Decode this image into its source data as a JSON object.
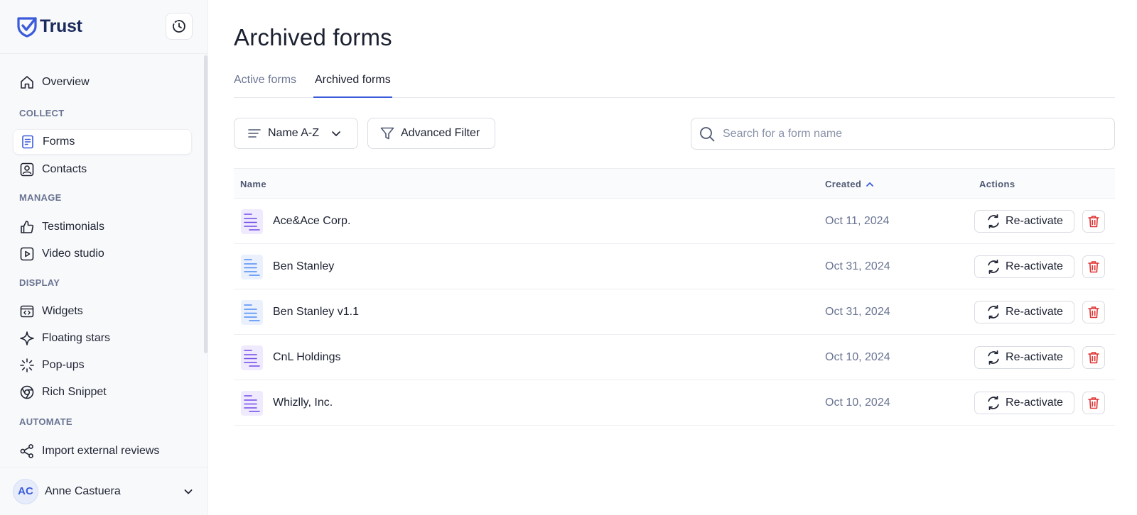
{
  "brand": {
    "name": "Trust",
    "accent": "#3b5bdb"
  },
  "sidebar": {
    "overview": "Overview",
    "sections": {
      "collect": "COLLECT",
      "manage": "MANAGE",
      "display": "DISPLAY",
      "automate": "AUTOMATE"
    },
    "items": {
      "forms": "Forms",
      "contacts": "Contacts",
      "testimonials": "Testimonials",
      "video_studio": "Video studio",
      "widgets": "Widgets",
      "floating_stars": "Floating stars",
      "popups": "Pop-ups",
      "rich_snippet": "Rich Snippet",
      "import_reviews": "Import external reviews"
    },
    "active_item": "forms",
    "user": {
      "initials": "AC",
      "name": "Anne Castuera"
    }
  },
  "main": {
    "title": "Archived forms",
    "tabs": [
      {
        "label": "Active forms",
        "active": false
      },
      {
        "label": "Archived forms",
        "active": true
      }
    ],
    "sort": {
      "label": "Name A-Z"
    },
    "filter": {
      "label": "Advanced Filter"
    },
    "search": {
      "placeholder": "Search for a form name",
      "value": ""
    },
    "table": {
      "columns": {
        "name": "Name",
        "created": "Created",
        "actions": "Actions"
      },
      "sort_column": "created",
      "sort_direction": "ascending",
      "rows": [
        {
          "name": "Ace&Ace Corp.",
          "created": "Oct 11, 2024",
          "icon_color": "purple",
          "action": "Re-activate"
        },
        {
          "name": "Ben Stanley",
          "created": "Oct 31, 2024",
          "icon_color": "blue",
          "action": "Re-activate"
        },
        {
          "name": "Ben Stanley v1.1",
          "created": "Oct 31, 2024",
          "icon_color": "blue",
          "action": "Re-activate"
        },
        {
          "name": "CnL Holdings",
          "created": "Oct 10, 2024",
          "icon_color": "purple",
          "action": "Re-activate"
        },
        {
          "name": "Whizlly, Inc.",
          "created": "Oct 10, 2024",
          "icon_color": "purple",
          "action": "Re-activate"
        }
      ]
    }
  },
  "colors": {
    "danger": "#e03131",
    "purple_icon": "#7048e8",
    "blue_icon": "#4c8bf5"
  }
}
